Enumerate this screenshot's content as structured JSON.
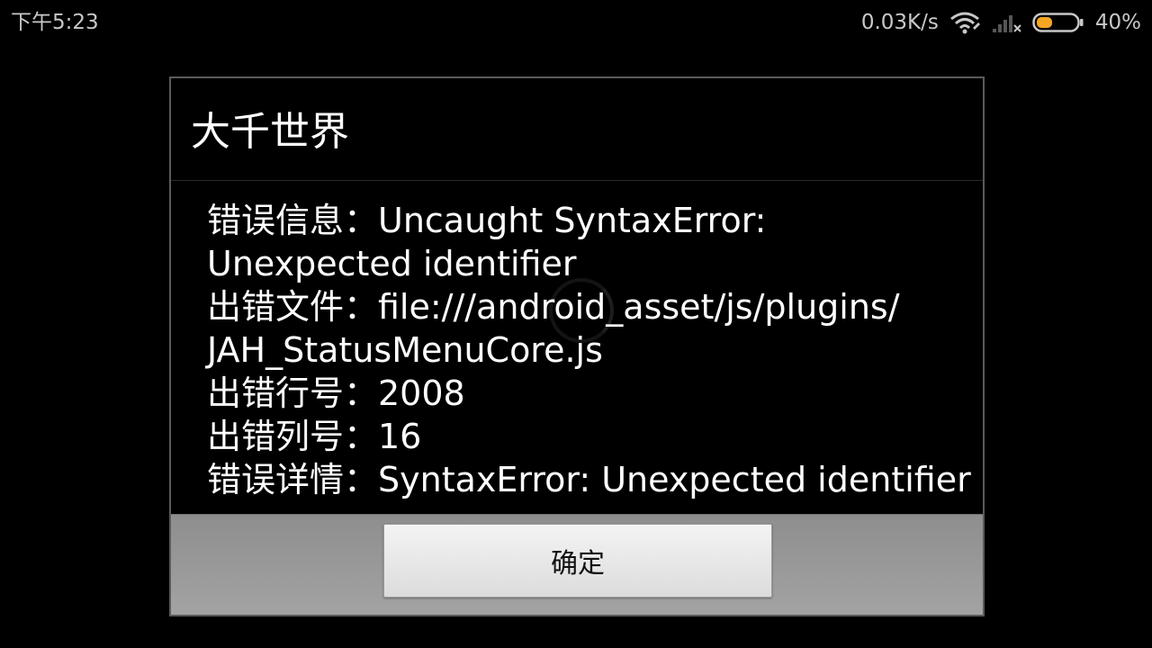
{
  "status_bar": {
    "time": "下午5:23",
    "net_speed": "0.03K/s",
    "battery_percent": "40%",
    "battery_level": 0.4,
    "battery_color": "#f5a623",
    "icons": [
      "wifi-icon",
      "signal-icon",
      "battery-icon"
    ]
  },
  "dialog": {
    "title": "大千世界",
    "lines": [
      "错误信息：Uncaught SyntaxError:",
      "Unexpected identifier",
      "出错文件：file:///android_asset/js/plugins/",
      "JAH_StatusMenuCore.js",
      "出错行号：2008",
      "出错列号：16",
      "错误详情：SyntaxError: Unexpected identifier"
    ],
    "ok_button_label": "确定"
  }
}
